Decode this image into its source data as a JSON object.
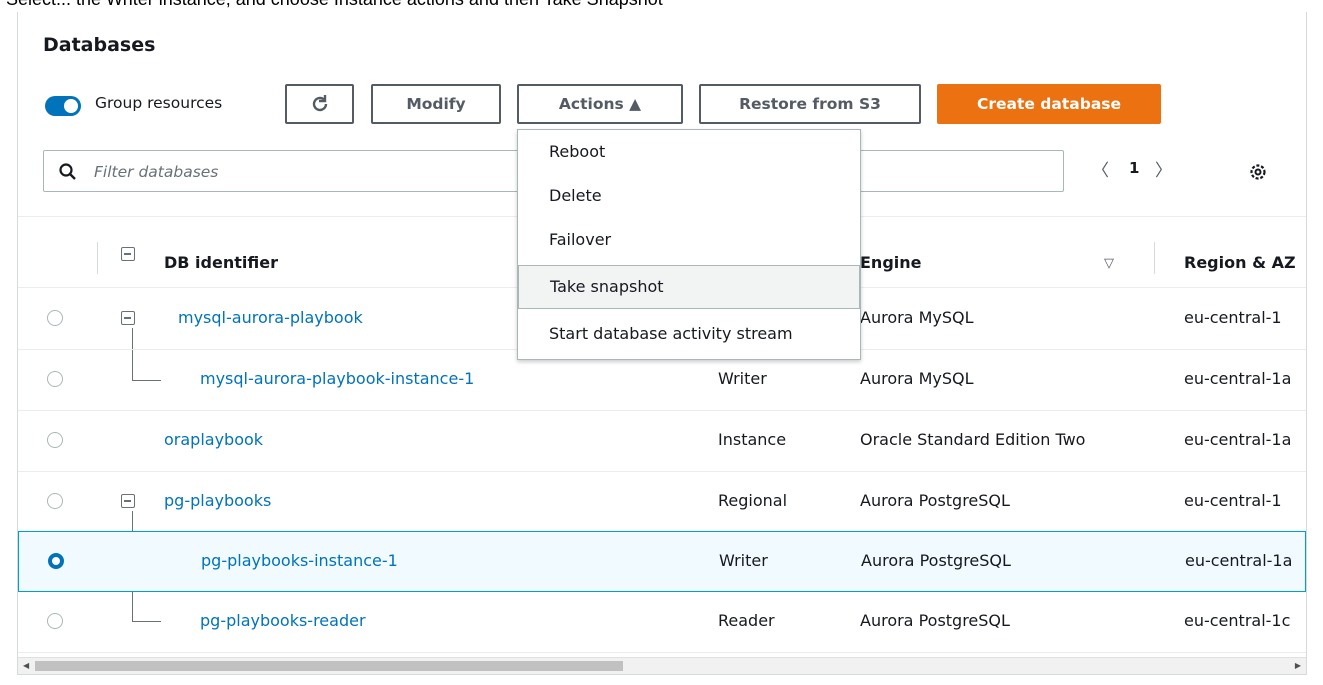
{
  "instruction_banner": "Select... the Writer instance, and choose Instance actions and then Take Snapshot",
  "panel": {
    "title": "Databases"
  },
  "toolbar": {
    "group_resources_label": "Group resources",
    "modify_label": "Modify",
    "actions_label": "Actions ▲",
    "restore_label": "Restore from S3",
    "create_label": "Create database"
  },
  "search": {
    "placeholder": "Filter databases"
  },
  "pagination": {
    "prev": "〈",
    "page": "1",
    "next": "〉"
  },
  "dropdown": {
    "items": [
      "Reboot",
      "Delete",
      "Failover",
      "Take snapshot",
      "Start database activity stream"
    ]
  },
  "table": {
    "headers": {
      "identifier": "DB identifier",
      "engine": "Engine",
      "engine_sort": "▽",
      "region": "Region & AZ"
    },
    "rows": [
      {
        "id": "mysql-aurora-playbook",
        "role": "",
        "engine": "Aurora MySQL",
        "region": "eu-central-1"
      },
      {
        "id": "mysql-aurora-playbook-instance-1",
        "role": "Writer",
        "engine": "Aurora MySQL",
        "region": "eu-central-1a"
      },
      {
        "id": "oraplaybook",
        "role": "Instance",
        "engine": "Oracle Standard Edition Two",
        "region": "eu-central-1a"
      },
      {
        "id": "pg-playbooks",
        "role": "Regional",
        "engine": "Aurora PostgreSQL",
        "region": "eu-central-1"
      },
      {
        "id": "pg-playbooks-instance-1",
        "role": "Writer",
        "engine": "Aurora PostgreSQL",
        "region": "eu-central-1a"
      },
      {
        "id": "pg-playbooks-reader",
        "role": "Reader",
        "engine": "Aurora PostgreSQL",
        "region": "eu-central-1c"
      }
    ]
  },
  "colors": {
    "accent": "#0073bb",
    "primary_button": "#ec7211"
  }
}
